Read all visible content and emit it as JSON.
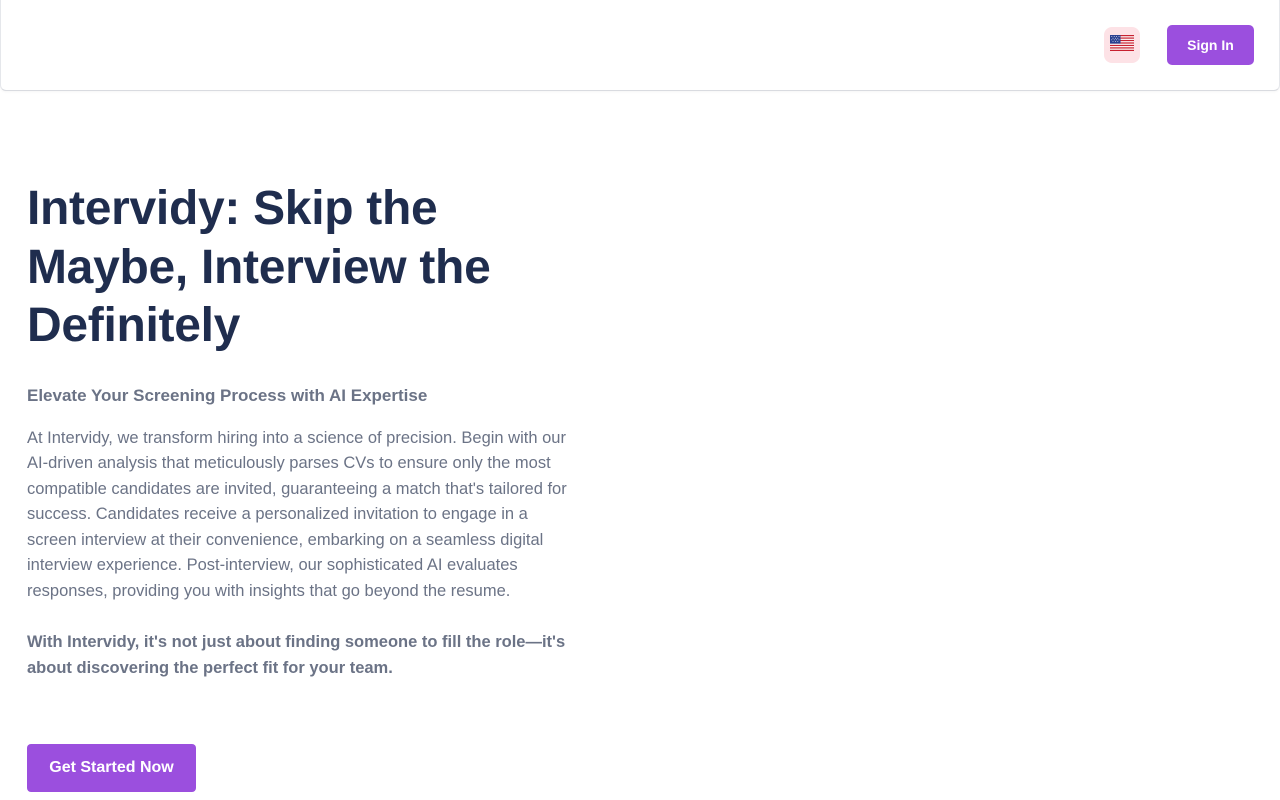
{
  "header": {
    "language": {
      "icon": "us-flag-icon",
      "background": "#fde2e6"
    },
    "sign_in_label": "Sign In"
  },
  "hero": {
    "title": "Intervidy: Skip the Maybe, Interview the Definitely",
    "subtitle": "Elevate Your Screening Process with AI Expertise",
    "body": "At Intervidy, we transform hiring into a science of precision. Begin with our AI-driven analysis that meticulously parses CVs to ensure only the most compatible candidates are invited, guaranteeing a match that's tailored for success. Candidates receive a personalized invitation to engage in a screen interview at their convenience, embarking on a seamless digital interview experience. Post-interview, our sophisticated AI evaluates responses, providing you with insights that go beyond the resume.",
    "closing": "With Intervidy, it's not just about finding someone to fill the role—it's about discovering the perfect fit for your team.",
    "cta_label": "Get Started Now"
  },
  "colors": {
    "brand": "#9b4fde",
    "heading": "#1f2d4e",
    "text": "#6b7386"
  }
}
